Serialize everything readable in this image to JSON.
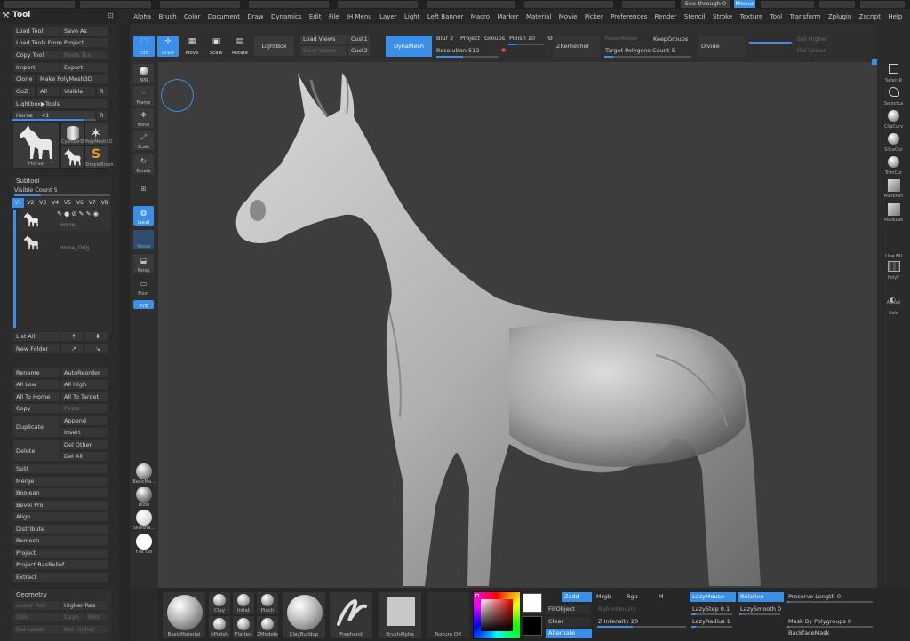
{
  "top_strip": {
    "see_through": "See-through 0",
    "menus": "Menus"
  },
  "menu_bar": [
    "Alpha",
    "Brush",
    "Color",
    "Document",
    "Draw",
    "Dynamics",
    "Edit",
    "File",
    "JH Menu",
    "Layer",
    "Light",
    "Left Banner",
    "Macro",
    "Marker",
    "Material",
    "Movie",
    "Picker",
    "Preferences",
    "Render",
    "Stencil",
    "Stroke",
    "Texture",
    "Tool",
    "Transform",
    "Zplugin",
    "Zscript",
    "Help"
  ],
  "tool_panel": {
    "title": "Tool",
    "buttons": [
      "Load Tool",
      "Save As",
      "Load Tools From Project",
      "Copy Tool",
      "Paste Tool",
      "Import",
      "Export",
      "Clone",
      "Make PolyMesh3D",
      "GoZ",
      "All",
      "Visible",
      "R",
      "Lightbox▶Tools"
    ],
    "current_tool": {
      "name": "Horse",
      "value": "41",
      "r_label": "R"
    },
    "tool_thumbs": [
      "Horse",
      "Cylinder3D",
      "PolyMesh3D",
      "",
      "SimpleBrush"
    ],
    "subtool": {
      "title": "Subtool",
      "visible_count": "Visible Count 5",
      "tabs": [
        "V1",
        "V2",
        "V3",
        "V4",
        "V5",
        "V6",
        "V7",
        "V8"
      ],
      "items": [
        "Horse",
        "Horse_Orig"
      ]
    },
    "list_buttons": [
      "List All",
      "New Folder"
    ],
    "actions": [
      "Rename",
      "AutoReorder",
      "All Low",
      "All High",
      "All To Home",
      "All To Target",
      "Copy",
      "Paste",
      "Duplicate",
      "Append",
      "Insert",
      "Delete",
      "Del Other",
      "Del All",
      "Split",
      "Merge",
      "Boolean",
      "Bevel Pro",
      "Align",
      "Distribute",
      "Remesh",
      "Project",
      "Project BasRelief",
      "Extract"
    ],
    "geometry": {
      "title": "Geometry",
      "items": [
        "Lower Res",
        "Higher Res",
        "Sdiv",
        "Cage",
        "Rstr",
        "Del Lower",
        "Del Higher"
      ]
    }
  },
  "toolbar": {
    "modes": [
      "Edit",
      "Draw",
      "Move",
      "Scale",
      "Rotate"
    ],
    "lightbox": "LightBox",
    "load_views": "Load Views",
    "save_views": "Save Views",
    "cust1": "Cust1",
    "cust2": "Cust2",
    "dynamesh": "DynaMesh",
    "blur": "Blur",
    "blur_value": "2",
    "project": "Project",
    "groups": "Groups",
    "polish": "Polish",
    "polish_value": "10",
    "resolution": "Resolution",
    "resolution_value": "512",
    "zremesher": "ZRemesher",
    "freeze_borders": "FreezeBorder",
    "keep_groups": "KeepGroups",
    "target_polygons": "Target Polygons Count",
    "target_polygons_value": "5",
    "divide": "Divide",
    "del_higher": "Del Higher",
    "del_lower": "Del Lower"
  },
  "left_shelf": [
    "BPR",
    "Frame",
    "Move",
    "Scale",
    "Rotate",
    "Local",
    "Xpose",
    "Persp",
    "Floor",
    "XYZ",
    "BasicMa...",
    "Blinn",
    "Skinsha...",
    "Flat Col"
  ],
  "right_shelf": [
    "SelectR",
    "SelectLa",
    "ClipCurv",
    "SliceCur",
    "TrimCur",
    "MaskPen",
    "MaskLas",
    "Line Fill",
    "PolyF",
    "Actual",
    "Solo"
  ],
  "bottom": {
    "brushes": [
      "BasicMaterial",
      "Clay",
      "Inflat",
      "Pinch",
      "hPolish",
      "Flatten",
      "ZModele",
      "ClayBuildup",
      "Freehand",
      "BrushAlpha",
      "Texture Off"
    ],
    "zadd": "Zadd",
    "mrgb": "Mrgb",
    "rgb": "Rgb",
    "m": "M",
    "fill_object": "FillObject",
    "clear": "Clear",
    "alternate": "Alternate",
    "rgb_intensity": "Rgb Intensity",
    "z_intensity": "Z Intensity",
    "z_intensity_value": "20",
    "lazymouse": "LazyMouse",
    "relative": "Relative",
    "lazystep": "LazyStep",
    "lazystep_value": "0.1",
    "lazysmooth": "LazySmooth",
    "lazysmooth_value": "0",
    "lazyradius": "LazyRadius",
    "lazyradius_value": "1",
    "preserve_length": "Preserve Length",
    "preserve_length_value": "0",
    "mask_by_polygroups": "Mask By Polygroups",
    "mask_by_polygroups_value": "0",
    "backface_mask": "BackfaceMask"
  },
  "colors": {
    "accent": "#3b8fe6",
    "bg": "#2a2a2a",
    "viewport": "#3d3d3d"
  }
}
